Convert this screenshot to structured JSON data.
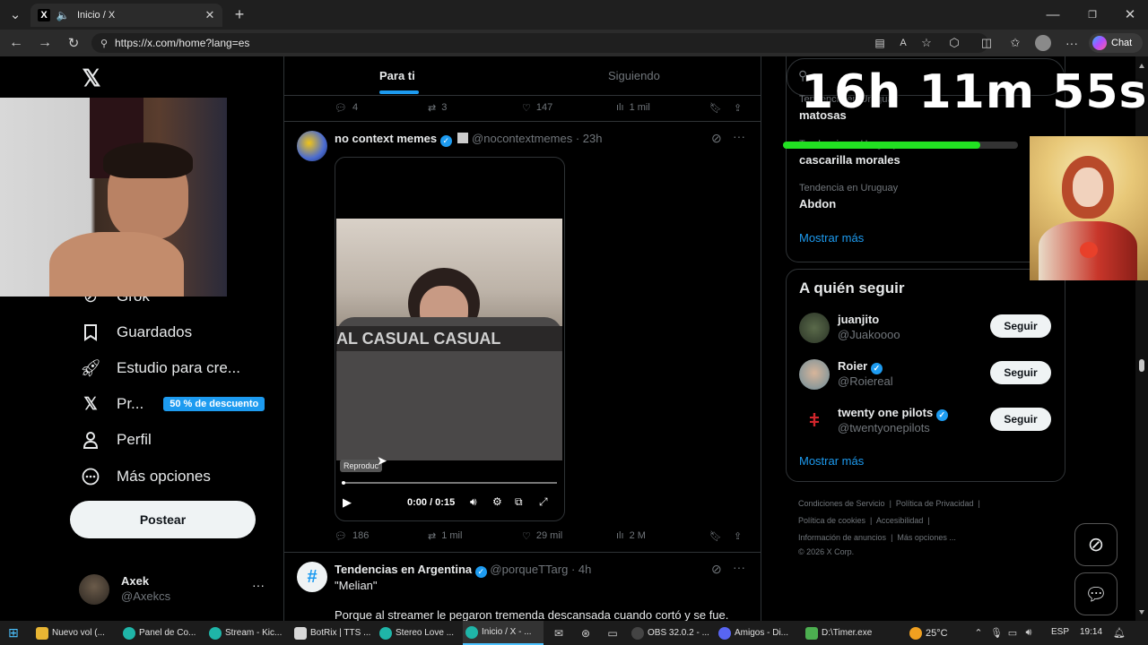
{
  "browser": {
    "tab_title": "Inicio / X",
    "url": "https://x.com/home?lang=es",
    "chat_label": "Chat"
  },
  "timer": {
    "text": "16h 11m 55s",
    "progress": 0.84
  },
  "feed_tabs": {
    "for_you": "Para ti",
    "following": "Siguiendo"
  },
  "sidebar": {
    "items": [
      {
        "label": "Grok",
        "icon": "grok-icon"
      },
      {
        "label": "Guardados",
        "icon": "bookmark-icon"
      },
      {
        "label": "Estudio para cre...",
        "icon": "rocket-icon"
      },
      {
        "label": "Pr...",
        "icon": "x-logo-icon",
        "badge": "50 % de descuento"
      },
      {
        "label": "Perfil",
        "icon": "person-icon"
      },
      {
        "label": "Más opciones",
        "icon": "more-circle-icon"
      }
    ],
    "post_button": "Postear",
    "account": {
      "name": "Axek",
      "handle": "@Axekcs"
    }
  },
  "prev_tweet_actions": {
    "replies": "4",
    "reposts": "3",
    "likes": "147",
    "views": "1 mil"
  },
  "tweet1": {
    "name": "no context memes",
    "handle": "@nocontextmemes",
    "time": "· 23h",
    "video": {
      "tooltip": "Reproduc",
      "time": "0:00 / 0:15",
      "banner_text": "AL CASUAL CASUAL"
    },
    "actions": {
      "replies": "186",
      "reposts": "1 mil",
      "likes": "29 mil",
      "views": "2 M"
    }
  },
  "tweet2": {
    "name": "Tendencias en Argentina",
    "handle": "@porqueTTarg",
    "time": "· 4h",
    "line1": "\"Melian\"",
    "line2": "Porque al streamer le pegaron tremenda descansada cuando cortó y se fue."
  },
  "trends": {
    "items": [
      {
        "context": "Tendencia en Uruguay",
        "name": "matosas"
      },
      {
        "context": "Tendencia en Uruguay",
        "name": "cascarilla morales"
      },
      {
        "context": "Tendencia en Uruguay",
        "name": "Abdon"
      }
    ],
    "show_more": "Mostrar más"
  },
  "who_to_follow": {
    "title": "A quién seguir",
    "users": [
      {
        "name": "juanjito",
        "handle": "@Juakoooo",
        "verified": false,
        "button": "Seguir"
      },
      {
        "name": "Roier",
        "handle": "@Roiereal",
        "verified": true,
        "button": "Seguir"
      },
      {
        "name": "twenty one pilots",
        "handle": "@twentyonepilots",
        "verified": true,
        "button": "Seguir"
      }
    ],
    "show_more": "Mostrar más"
  },
  "footer": {
    "links": [
      "Condiciones de Servicio",
      "Política de Privacidad",
      "Política de cookies",
      "Accesibilidad",
      "Información de anuncios",
      "Más opciones ..."
    ],
    "copyright": "© 2026 X Corp."
  },
  "taskbar": {
    "items": [
      "Nuevo vol (...",
      "Panel de Co...",
      "Stream - Kic...",
      "BotRix | TTS ...",
      "Stereo Love ...",
      "Inicio / X - ...",
      "OBS 32.0.2 - ...",
      "Amigos - Di...",
      "D:\\Timer.exe"
    ],
    "temperature": "25°C",
    "language": "ESP",
    "clock": "19:14"
  },
  "colors": {
    "accent": "#1d9bf0",
    "badge": "#1d9bf0",
    "timer_bar": "#22e022",
    "background": "#000000"
  }
}
